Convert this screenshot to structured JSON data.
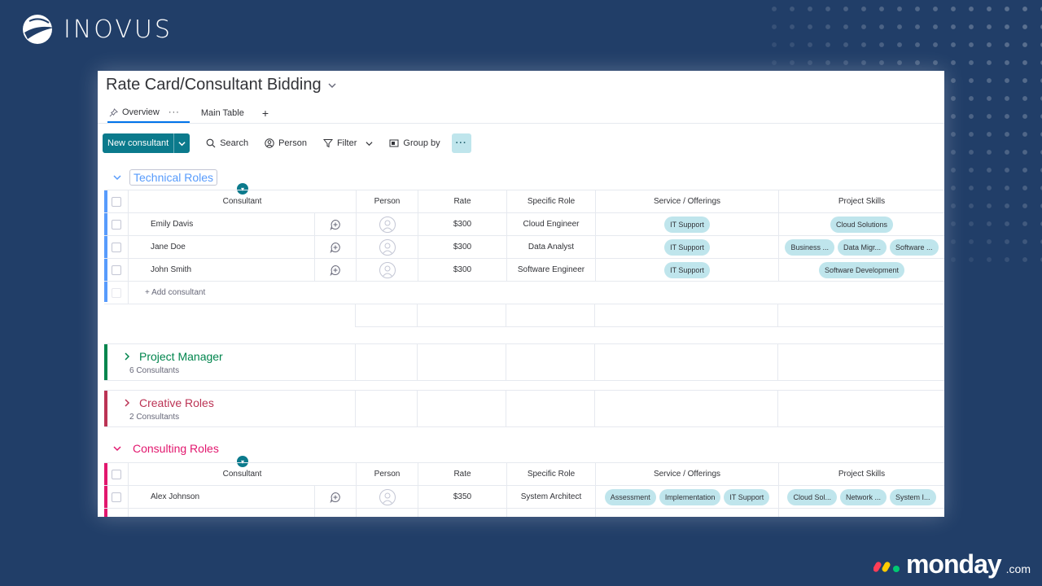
{
  "brand": {
    "inovus": "INOVUS",
    "monday_word": "monday",
    "monday_suffix": ".com"
  },
  "board": {
    "title": "Rate Card/Consultant Bidding"
  },
  "tabs": [
    {
      "label": "Overview"
    },
    {
      "label": "Main Table"
    },
    {
      "label": "+"
    }
  ],
  "toolbar": {
    "new_label": "New consultant",
    "search": "Search",
    "person": "Person",
    "filter": "Filter",
    "group_by": "Group by",
    "more": "···"
  },
  "columns": [
    "Consultant",
    "Person",
    "Rate",
    "Specific Role",
    "Service / Offerings",
    "Project Skills"
  ],
  "groups": {
    "technical": {
      "title": "Technical Roles",
      "color": "#579bfc",
      "add_label": "+ Add consultant",
      "rows": [
        {
          "name": "Emily Davis",
          "rate": "$300",
          "role": "Cloud Engineer",
          "services": [
            "IT Support"
          ],
          "skills": [
            "Cloud Solutions"
          ]
        },
        {
          "name": "Jane Doe",
          "rate": "$300",
          "role": "Data Analyst",
          "services": [
            "IT Support"
          ],
          "skills": [
            "Business ...",
            "Data Migr...",
            "Software ..."
          ]
        },
        {
          "name": "John Smith",
          "rate": "$300",
          "role": "Software Engineer",
          "services": [
            "IT Support"
          ],
          "skills": [
            "Software Development"
          ]
        }
      ]
    },
    "pm": {
      "title": "Project Manager",
      "subtitle": "6 Consultants",
      "color": "#00854d"
    },
    "creative": {
      "title": "Creative Roles",
      "subtitle": "2 Consultants",
      "color": "#bb3354"
    },
    "consulting": {
      "title": "Consulting Roles",
      "color": "#e2176e",
      "rows": [
        {
          "name": "Alex Johnson",
          "rate": "$350",
          "role": "System Architect",
          "services": [
            "Assessment",
            "Implementation",
            "IT Support"
          ],
          "skills": [
            "Cloud Sol...",
            "Network ...",
            "System I..."
          ]
        }
      ]
    }
  }
}
